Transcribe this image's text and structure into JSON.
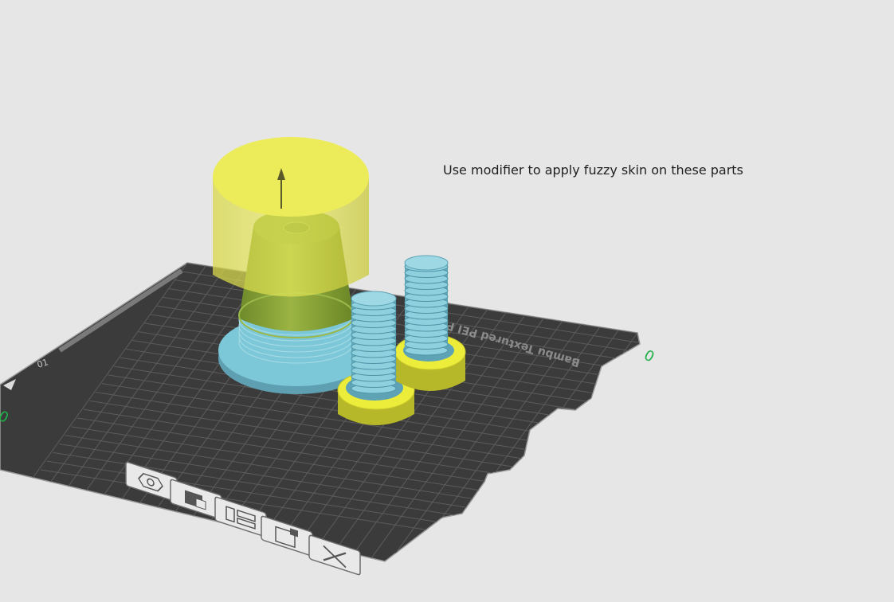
{
  "annotation": {
    "text": "Use modifier to apply fuzzy skin on these parts"
  },
  "plate": {
    "name": "Bambu Textured PEI Plate",
    "label_text": "Bambu Textured PEI Pla",
    "number_label": "01",
    "colors": {
      "surface": "#3b3b3b",
      "grid": "#5a5a5a",
      "border": "#9a9a9a"
    }
  },
  "axes": {
    "x_mark": "0",
    "y_mark": "0",
    "color": "#1fb14a"
  },
  "models": {
    "modifier_color": "#ecec3a",
    "part_color": "#7cc7d8",
    "selected_part_color": "#8ca63a"
  },
  "plate_toolbar": [
    {
      "name": "auto-orient-icon",
      "label": "Auto orient"
    },
    {
      "name": "arrange-icon",
      "label": "Arrange"
    },
    {
      "name": "plate-settings-icon",
      "label": "Plate settings"
    },
    {
      "name": "lock-plate-icon",
      "label": "Lock"
    },
    {
      "name": "delete-plate-icon",
      "label": "Delete plate"
    }
  ]
}
